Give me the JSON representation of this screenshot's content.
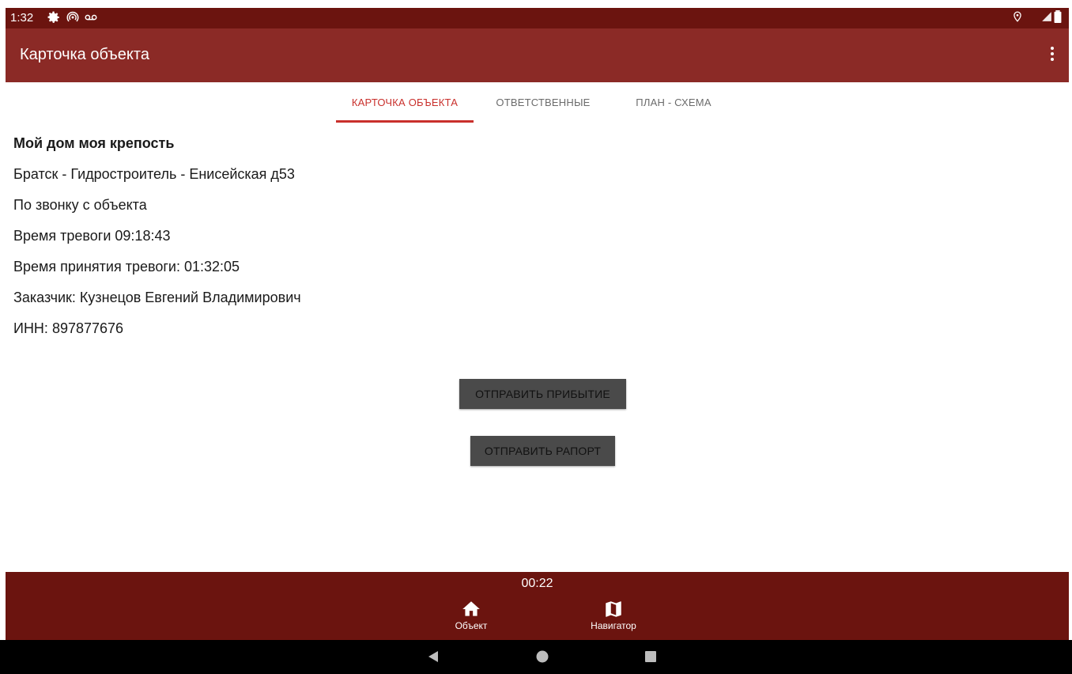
{
  "status_bar": {
    "time": "1:32",
    "icons_left": [
      "gear-icon",
      "hotspot-icon",
      "voicemail-icon"
    ],
    "icons_right": [
      "location-icon",
      "signal-icon",
      "battery-icon"
    ]
  },
  "app_bar": {
    "title": "Карточка объекта",
    "menu_icon": "more-vert-icon"
  },
  "tabs": [
    {
      "label": "КАРТОЧКА ОБЪЕКТА",
      "active": true
    },
    {
      "label": "ОТВЕТСТВЕННЫЕ",
      "active": false
    },
    {
      "label": "ПЛАН - СХЕМА",
      "active": false
    }
  ],
  "object_card": {
    "name": "Мой дом моя крепость",
    "address": "Братск - Гидростроитель - Енисейская д53",
    "alarm_source": "По звонку с объекта",
    "alarm_time": "Время тревоги 09:18:43",
    "accept_time": "Время принятия тревоги: 01:32:05",
    "customer": "Заказчик: Кузнецов Евгений Владимирович",
    "inn": "ИНН: 897877676"
  },
  "actions": {
    "send_arrival": "ОТПРАВИТЬ ПРИБЫТИЕ",
    "send_report": "ОТПРАВИТЬ РАПОРТ"
  },
  "bottom_nav": {
    "timer": "00:22",
    "items": [
      {
        "label": "Объект",
        "icon": "home-icon"
      },
      {
        "label": "Навигатор",
        "icon": "map-icon"
      }
    ]
  },
  "system_nav": [
    "back-icon",
    "home-circle-icon",
    "recents-icon"
  ],
  "colors": {
    "status_bar": "#6b140f",
    "app_bar": "#8b2a26",
    "accent": "#c9302c",
    "button": "#4a4a4a",
    "bottom_nav": "#6b140f"
  }
}
